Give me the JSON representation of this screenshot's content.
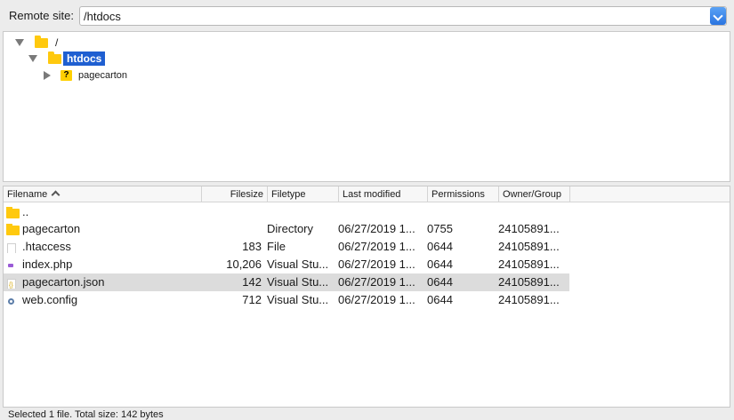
{
  "site_bar": {
    "label": "Remote site:",
    "path": "/htdocs"
  },
  "tree": {
    "items": [
      {
        "label": "/",
        "icon": "folder-icon",
        "expanded": true
      },
      {
        "label": "htdocs",
        "icon": "folder-icon",
        "expanded": true,
        "selected": true
      },
      {
        "label": "pagecarton",
        "icon": "folder-unknown-icon",
        "expanded": false
      }
    ]
  },
  "file_list": {
    "columns": {
      "filename": "Filename",
      "filesize": "Filesize",
      "filetype": "Filetype",
      "modified": "Last modified",
      "permissions": "Permissions",
      "owner": "Owner/Group"
    },
    "rows": [
      {
        "name": "..",
        "size": "",
        "type": "",
        "modified": "",
        "perms": "",
        "owner": "",
        "icon": "folder-icon"
      },
      {
        "name": "pagecarton",
        "size": "",
        "type": "Directory",
        "modified": "06/27/2019 1...",
        "perms": "0755",
        "owner": "24105891...",
        "icon": "folder-icon"
      },
      {
        "name": ".htaccess",
        "size": "183",
        "type": "File",
        "modified": "06/27/2019 1...",
        "perms": "0644",
        "owner": "24105891...",
        "icon": "file-icon"
      },
      {
        "name": "index.php",
        "size": "10,206",
        "type": "Visual Stu...",
        "modified": "06/27/2019 1...",
        "perms": "0644",
        "owner": "24105891...",
        "icon": "php-file-icon"
      },
      {
        "name": "pagecarton.json",
        "size": "142",
        "type": "Visual Stu...",
        "modified": "06/27/2019 1...",
        "perms": "0644",
        "owner": "24105891...",
        "icon": "json-file-icon",
        "selected": true
      },
      {
        "name": "web.config",
        "size": "712",
        "type": "Visual Stu...",
        "modified": "06/27/2019 1...",
        "perms": "0644",
        "owner": "24105891...",
        "icon": "config-file-icon"
      }
    ]
  },
  "status": {
    "text": "Selected 1 file. Total size: 142 bytes"
  },
  "colors": {
    "selection_accent": "#1f5fd1",
    "folder": "#ffc90e",
    "row_selected": "#dcdcdc"
  }
}
